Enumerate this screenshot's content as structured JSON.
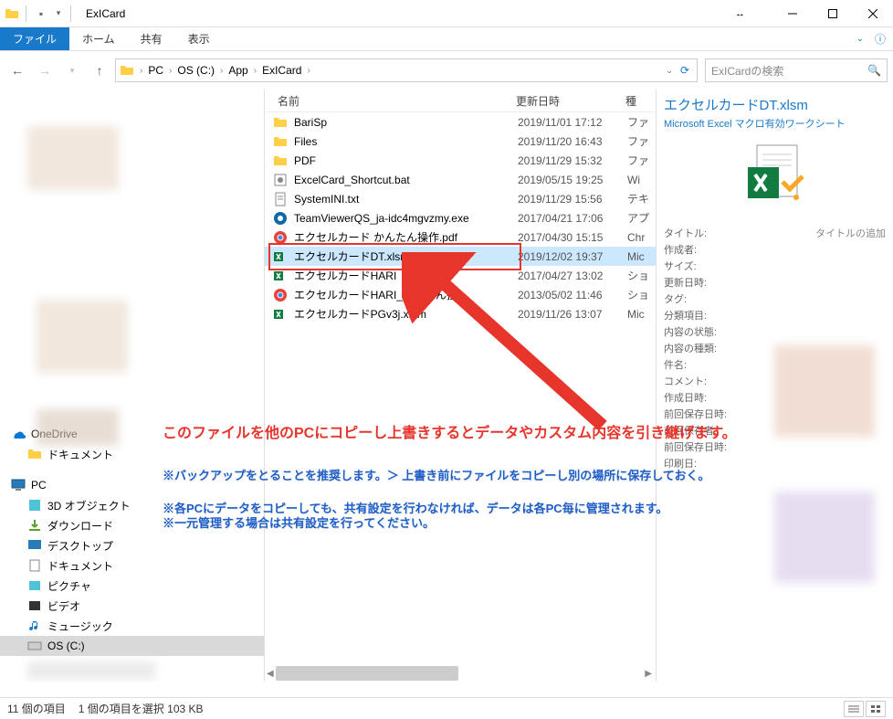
{
  "title": "ExICard",
  "ribbon": {
    "file": "ファイル",
    "home": "ホーム",
    "share": "共有",
    "view": "表示"
  },
  "breadcrumb": [
    "PC",
    "OS (C:)",
    "App",
    "ExICard"
  ],
  "search_placeholder": "ExICardの検索",
  "columns": {
    "name": "名前",
    "date": "更新日時",
    "type": "種"
  },
  "files": [
    {
      "icon": "folder",
      "name": "BariSp",
      "date": "2019/11/01 17:12",
      "type": "ファ"
    },
    {
      "icon": "folder",
      "name": "Files",
      "date": "2019/11/20 16:43",
      "type": "ファ"
    },
    {
      "icon": "folder",
      "name": "PDF",
      "date": "2019/11/29 15:32",
      "type": "ファ"
    },
    {
      "icon": "bat",
      "name": "ExcelCard_Shortcut.bat",
      "date": "2019/05/15 19:25",
      "type": "Wi"
    },
    {
      "icon": "txt",
      "name": "SystemINI.txt",
      "date": "2019/11/29 15:56",
      "type": "テキ"
    },
    {
      "icon": "exe",
      "name": "TeamViewerQS_ja-idc4mgvzmy.exe",
      "date": "2017/04/21 17:06",
      "type": "アプ"
    },
    {
      "icon": "chrome",
      "name": "エクセルカード かんたん操作.pdf",
      "date": "2017/04/30 15:15",
      "type": "Chr"
    },
    {
      "icon": "xlsm",
      "name": "エクセルカードDT.xlsm",
      "date": "2019/12/02 19:37",
      "type": "Mic",
      "selected": true
    },
    {
      "icon": "xlsm",
      "name": "エクセルカードHARI",
      "date": "2017/04/27 13:02",
      "type": "ショ"
    },
    {
      "icon": "chrome",
      "name": "エクセルカードHARI_かんたん捏",
      "date": "2013/05/02 11:46",
      "type": "ショ"
    },
    {
      "icon": "xlam",
      "name": "エクセルカードPGv3j.xlam",
      "date": "2019/11/26 13:07",
      "type": "Mic"
    }
  ],
  "details": {
    "filename": "エクセルカードDT.xlsm",
    "filetype": "Microsoft Excel マクロ有効ワークシート",
    "addtitle": "タイトルの追加",
    "props": [
      "タイトル:",
      "作成者:",
      "サイズ:",
      "更新日時:",
      "タグ:",
      "分類項目:",
      "内容の状態:",
      "内容の種類:",
      "件名:",
      "コメント:",
      "作成日時:",
      "前回保存日時:",
      "前回保存者:",
      "前回保存日時:",
      "印刷日:"
    ]
  },
  "nav": {
    "onedrive": "OneDrive",
    "documents": "ドキュメント",
    "pc": "PC",
    "obj3d": "3D オブジェクト",
    "downloads": "ダウンロード",
    "desktop": "デスクトップ",
    "documents2": "ドキュメント",
    "pictures": "ピクチャ",
    "videos": "ビデオ",
    "music": "ミュージック",
    "osc": "OS (C:)"
  },
  "annotations": {
    "main": "このファイルを他のPCにコピーし上書きするとデータやカスタム内容を引き継げます。",
    "sub1": "※バックアップをとることを推奨します。＞ 上書き前にファイルをコピーし別の場所に保存しておく。",
    "sub2": "※各PCにデータをコピーしても、共有設定を行わなければ、データは各PC毎に管理されます。",
    "sub3": "※一元管理する場合は共有設定を行ってください。"
  },
  "status": {
    "count": "11 個の項目",
    "selected": "1 個の項目を選択 103 KB"
  }
}
